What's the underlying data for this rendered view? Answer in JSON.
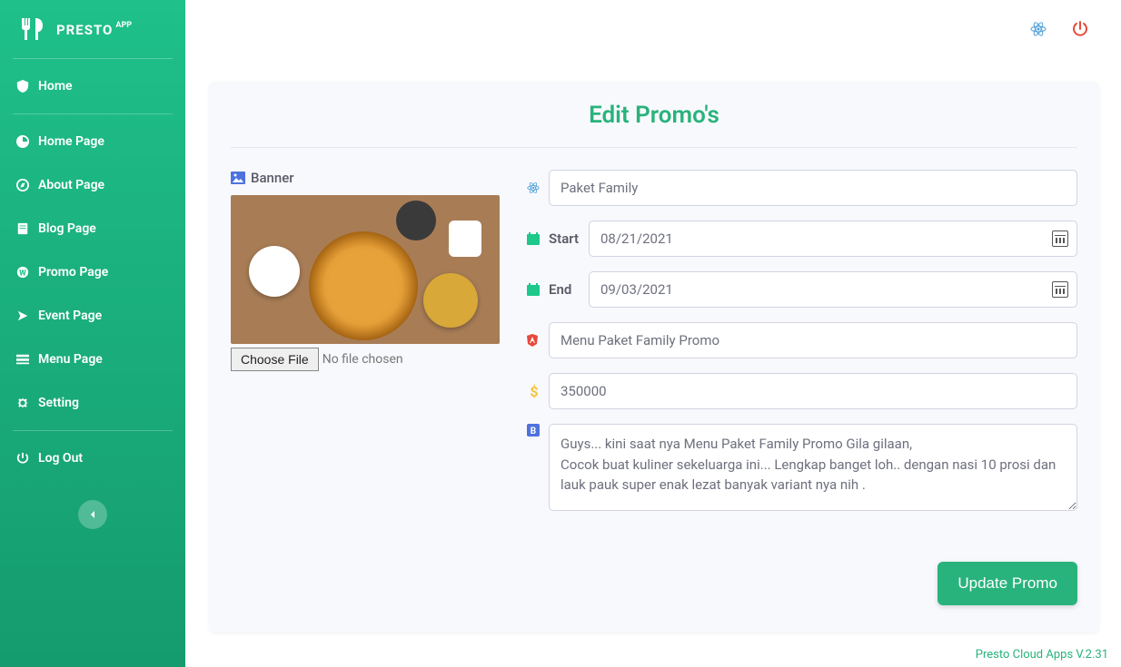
{
  "brand": {
    "title": "PRESTO",
    "sup": "APP"
  },
  "sidebar": {
    "items": [
      {
        "label": "Home",
        "icon": "shield-icon"
      },
      {
        "label": "Home Page",
        "icon": "dashboard-icon"
      },
      {
        "label": "About Page",
        "icon": "compass-icon"
      },
      {
        "label": "Blog Page",
        "icon": "document-icon"
      },
      {
        "label": "Promo Page",
        "icon": "badge-icon"
      },
      {
        "label": "Event Page",
        "icon": "event-icon"
      },
      {
        "label": "Menu Page",
        "icon": "menu-icon"
      },
      {
        "label": "Setting",
        "icon": "gear-icon"
      }
    ],
    "logout": "Log Out"
  },
  "page": {
    "title": "Edit Promo's"
  },
  "form": {
    "banner_label": "Banner",
    "file_button": "Choose File",
    "file_status": "No file chosen",
    "name_value": "Paket Family",
    "start_label": "Start",
    "start_value": "08/21/2021",
    "end_label": "End",
    "end_value": "09/03/2021",
    "subtitle_value": "Menu Paket Family Promo",
    "price_value": "350000",
    "desc_value": "Guys... kini saat nya Menu Paket Family Promo Gila gilaan,\nCocok buat kuliner sekeluarga ini... Lengkap banget loh.. dengan nasi 10 prosi dan lauk pauk super enak lezat banyak variant nya nih .",
    "submit_label": "Update Promo"
  },
  "footer": {
    "version": "Presto Cloud Apps V.2.31"
  }
}
